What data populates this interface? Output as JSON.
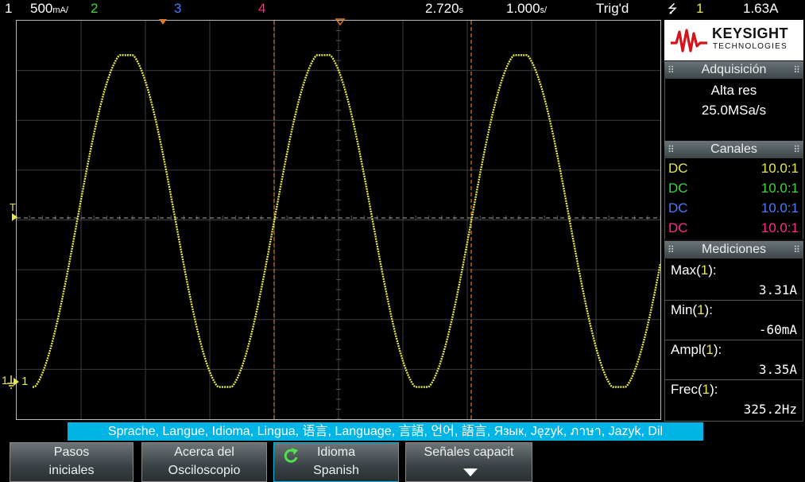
{
  "topbar": {
    "ch1_num": "1",
    "ch1_scale": "500",
    "ch1_unit": "mA/",
    "ch2_num": "2",
    "ch3_num": "3",
    "ch4_num": "4",
    "delay": "2.720",
    "delay_unit": "s",
    "timebase": "1.000",
    "timebase_unit": "s/",
    "trig_status": "Trig'd",
    "trig_source": "1",
    "trig_level": "1.63A"
  },
  "screen": {
    "trigger_level_label": "T",
    "ground_label": "1",
    "channel_marker": "1"
  },
  "brand": {
    "name": "KEYSIGHT",
    "sub": "TECHNOLOGIES"
  },
  "acquisition": {
    "title": "Adquisición",
    "mode": "Alta res",
    "rate": "25.0MSa/s"
  },
  "channels": {
    "title": "Canales",
    "rows": [
      {
        "coupling": "DC",
        "probe": "10.0:1",
        "color": "#e8e84a"
      },
      {
        "coupling": "DC",
        "probe": "10.0:1",
        "color": "#3ad83a"
      },
      {
        "coupling": "DC",
        "probe": "10.0:1",
        "color": "#4a78ff"
      },
      {
        "coupling": "DC",
        "probe": "10.0:1",
        "color": "#ff2a8a"
      }
    ]
  },
  "measurements": {
    "title": "Mediciones",
    "items": [
      {
        "name": "Max(",
        "src": "1",
        "close": "):",
        "value": "3.31A"
      },
      {
        "name": "Min(",
        "src": "1",
        "close": "):",
        "value": "-60mA"
      },
      {
        "name": "Ampl(",
        "src": "1",
        "close": "):",
        "value": "3.35A"
      },
      {
        "name": "Frec(",
        "src": "1",
        "close": "):",
        "value": "325.2Hz"
      }
    ]
  },
  "language_banner": "Sprache, Langue, Idioma, Lingua, 语言, Language, 言語, 언어, 語言, Язык, Język, ภาษา, Jazyk, Dil",
  "softkeys": [
    {
      "line1": "Pasos",
      "line2": "iniciales"
    },
    {
      "line1": "Acerca del",
      "line2": "Osciloscopio"
    },
    {
      "line1": "Idioma",
      "line2": "Spanish"
    },
    {
      "line1": "Señales capacit",
      "line2": ""
    }
  ],
  "colors": {
    "ch1": "#e8e84a",
    "ch2": "#3ad83a",
    "ch3": "#4a78ff",
    "ch4": "#ff2a8a",
    "cursor": "#e07a2a",
    "banner": "#00b4e6"
  }
}
